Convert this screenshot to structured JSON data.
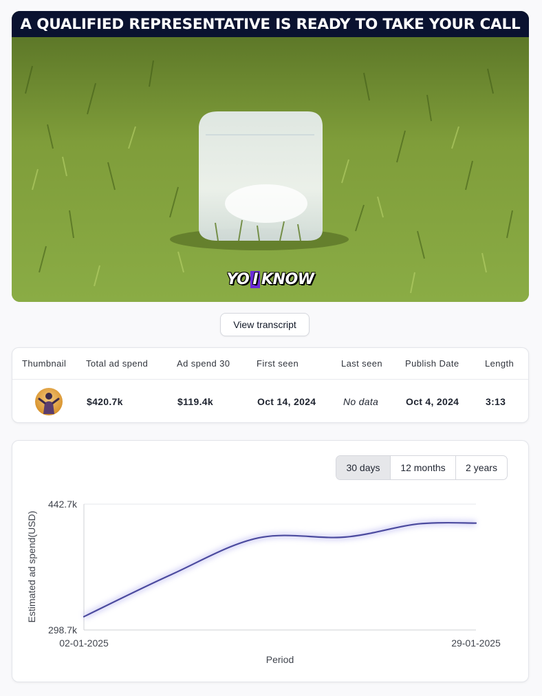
{
  "video": {
    "banner_text": "A QUALIFIED REPRESENTATIVE IS READY TO TAKE YOUR CALL",
    "caption_before": "YO",
    "caption_highlight": "I",
    "caption_after": "KNOW"
  },
  "transcript_button": {
    "label": "View transcript"
  },
  "stats": {
    "headers": {
      "thumbnail": "Thumbnail",
      "total_ad_spend": "Total ad spend",
      "ad_spend_30": "Ad spend 30",
      "first_seen": "First seen",
      "last_seen": "Last seen",
      "publish_date": "Publish Date",
      "length": "Length"
    },
    "row": {
      "total_ad_spend": "$420.7k",
      "ad_spend_30": "$119.4k",
      "first_seen": "Oct 14, 2024",
      "last_seen": "No data",
      "publish_date": "Oct 4, 2024",
      "length": "3:13"
    }
  },
  "range_options": {
    "days30": "30 days",
    "months12": "12 months",
    "years2": "2 years",
    "selected": "30 days"
  },
  "colors": {
    "line": "#4b4a9e",
    "selected_range_bg": "#e6e7ea"
  },
  "chart_data": {
    "type": "line",
    "title": "",
    "xlabel": "Period",
    "ylabel": "Estimated ad spend(USD)",
    "ylim": [
      298700,
      442700
    ],
    "y_ticks": [
      "442.7k",
      "298.7k"
    ],
    "x_ticks": [
      "02-01-2025",
      "29-01-2025"
    ],
    "grid": true,
    "series": [
      {
        "x": [
          "02-01-2025",
          "08-01-2025",
          "14-01-2025",
          "20-01-2025",
          "25-01-2025",
          "29-01-2025"
        ],
        "values": [
          314000,
          362000,
          404000,
          405000,
          420000,
          421000
        ]
      }
    ]
  }
}
